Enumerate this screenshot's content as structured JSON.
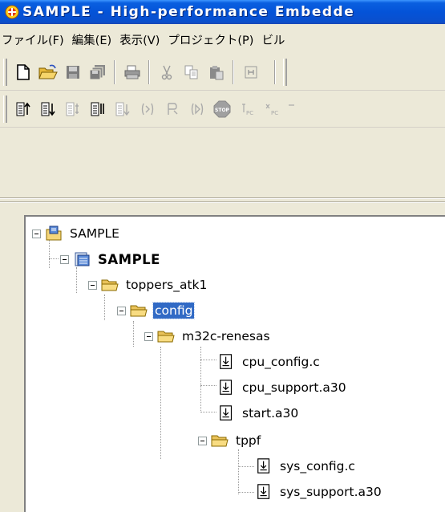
{
  "window": {
    "title": "SAMPLE - High-performance Embedde"
  },
  "menu": [
    {
      "label": "ファイル(F)"
    },
    {
      "label": "編集(E)"
    },
    {
      "label": "表示(V)"
    },
    {
      "label": "プロジェクト(P)"
    },
    {
      "label": "ビル"
    }
  ],
  "toolbar1": [
    {
      "icon": "new-file-icon"
    },
    {
      "icon": "open-folder-icon"
    },
    {
      "icon": "save-icon"
    },
    {
      "icon": "save-all-icon"
    },
    {
      "icon": "print-icon"
    },
    {
      "icon": "cut-icon"
    },
    {
      "icon": "copy-icon"
    },
    {
      "icon": "paste-icon"
    },
    {
      "icon": "find-icon"
    }
  ],
  "toolbar2": [
    {
      "icon": "sort-ascending-icon"
    },
    {
      "icon": "sort-descending-icon"
    },
    {
      "icon": "step-in-icon"
    },
    {
      "icon": "step-out-icon"
    },
    {
      "icon": "step-over-icon"
    },
    {
      "icon": "go-icon"
    },
    {
      "icon": "reset-go-icon"
    },
    {
      "icon": "run-icon"
    },
    {
      "icon": "stop-icon"
    },
    {
      "icon": "set-pc-icon"
    },
    {
      "icon": "show-pc-icon"
    }
  ],
  "tree": [
    {
      "label": "SAMPLE",
      "type": "workspace",
      "bold": false
    },
    {
      "label": "SAMPLE",
      "type": "project",
      "bold": true
    },
    {
      "label": "toppers_atk1",
      "type": "folder",
      "bold": false
    },
    {
      "label": "config",
      "type": "folder",
      "bold": false,
      "selected": true
    },
    {
      "label": "m32c-renesas",
      "type": "folder",
      "bold": false
    },
    {
      "label": "cpu_config.c",
      "type": "file",
      "bold": false
    },
    {
      "label": "cpu_support.a30",
      "type": "file",
      "bold": false
    },
    {
      "label": "start.a30",
      "type": "file",
      "bold": false
    },
    {
      "label": "tppf",
      "type": "folder",
      "bold": false
    },
    {
      "label": "sys_config.c",
      "type": "file",
      "bold": false
    },
    {
      "label": "sys_support.a30",
      "type": "file",
      "bold": false
    }
  ],
  "colors": {
    "titlebar": "#0453d8",
    "selection": "#316ac5",
    "folder": "#f5d67a",
    "background": "#ece9d8"
  }
}
